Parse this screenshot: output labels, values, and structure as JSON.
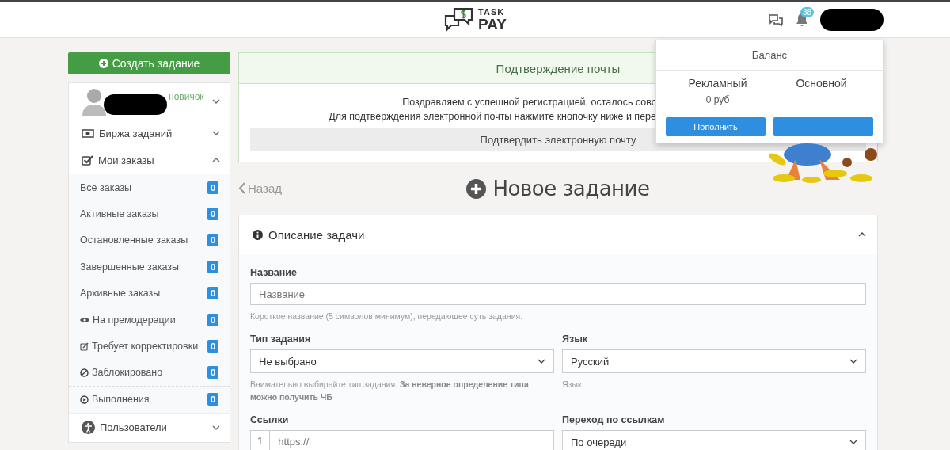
{
  "header": {
    "logo": {
      "top": "TASK",
      "bottom": "PAY"
    },
    "notifications_count": "38"
  },
  "sidebar": {
    "create_button": "Создать задание",
    "profile": {
      "rank": "новичок"
    },
    "sections": [
      {
        "label": "Биржа заданий",
        "expanded": false
      },
      {
        "label": "Мои заказы",
        "expanded": true
      }
    ],
    "orders": [
      {
        "kind": "plain",
        "label": "Все заказы",
        "count": "0"
      },
      {
        "kind": "plain",
        "label": "Активные заказы",
        "count": "0"
      },
      {
        "kind": "plain",
        "label": "Остановленные заказы",
        "count": "0"
      },
      {
        "kind": "plain",
        "label": "Завершенные заказы",
        "count": "0"
      },
      {
        "kind": "plain",
        "label": "Архивные заказы",
        "count": "0"
      },
      {
        "kind": "moderation",
        "label": "На премодерации",
        "count": "0"
      },
      {
        "kind": "correction",
        "label": "Требует корректировки",
        "count": "0"
      },
      {
        "kind": "blocked",
        "label": "Заблокировано",
        "count": "0"
      },
      {
        "kind": "running",
        "label": "Выполнения",
        "count": "0"
      }
    ],
    "users": {
      "label": "Пользователи",
      "expanded": false
    }
  },
  "email_confirm": {
    "title": "Подтверждение почты",
    "lines": [
      "Поздравляем с успешной регистрацией, осталось совс",
      "Для подтверждения электронной почты нажмите кнопочку ниже и пере"
    ],
    "button": "Подтвердить электронную почту"
  },
  "back_link": "Назад",
  "page_title": "Новое задание",
  "form": {
    "section_title": "Описание задачи",
    "expanded": true,
    "name": {
      "label": "Название",
      "placeholder": "Название",
      "hint": "Короткое название (5 символов минимум), передающее суть задания."
    },
    "type": {
      "label": "Тип задания",
      "value": "Не выбрано",
      "hint": "Внимательно выбирайте тип задания. **За неверное определение типа можно получить ЧБ**"
    },
    "language": {
      "label": "Язык",
      "value": "Русский",
      "hint": "Язык"
    },
    "links": {
      "label": "Ссылки",
      "number": "1",
      "placeholder": "https://"
    },
    "link_order": {
      "label": "Переход по ссылкам",
      "value": "По очереди"
    }
  },
  "balance": {
    "title": "Баланс",
    "columns": [
      {
        "label": "Рекламный",
        "value": "0 руб"
      },
      {
        "label": "Основной"
      }
    ],
    "topup_button": "Пополнить"
  }
}
